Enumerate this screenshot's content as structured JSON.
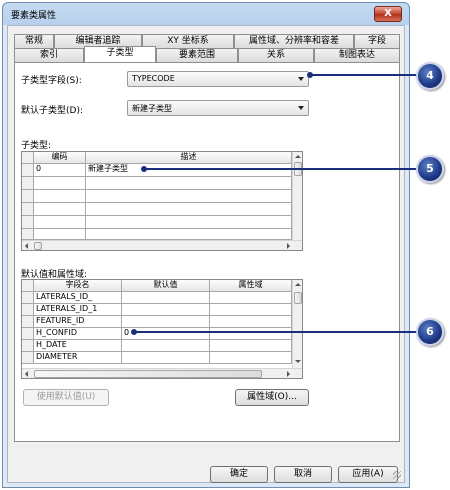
{
  "window": {
    "title": "要素类属性",
    "close_label": "X"
  },
  "tabs": {
    "row1": [
      "常规",
      "编辑者追踪",
      "XY 坐标系",
      "属性域、分辨率和容差",
      "字段"
    ],
    "row2": [
      "索引",
      "子类型",
      "要素范围",
      "关系",
      "制图表达"
    ],
    "active": "子类型"
  },
  "subtype_field": {
    "label": "子类型字段(S):",
    "value": "TYPECODE"
  },
  "default_subtype": {
    "label": "默认子类型(D):",
    "value": "新建子类型"
  },
  "subtypes": {
    "label": "子类型:",
    "columns": [
      "编码",
      "描述"
    ],
    "rows": [
      {
        "code": "0",
        "description": "新建子类型"
      }
    ]
  },
  "defaults": {
    "label": "默认值和属性域:",
    "columns": [
      "字段名",
      "默认值",
      "属性域"
    ],
    "rows": [
      {
        "field": "LATERALS_ID_",
        "default": "",
        "domain": ""
      },
      {
        "field": "LATERALS_ID_1",
        "default": "",
        "domain": ""
      },
      {
        "field": "FEATURE_ID",
        "default": "",
        "domain": ""
      },
      {
        "field": "H_CONFID",
        "default": "0",
        "domain": ""
      },
      {
        "field": "H_DATE",
        "default": "",
        "domain": ""
      },
      {
        "field": "DIAMETER",
        "default": "",
        "domain": ""
      }
    ]
  },
  "buttons": {
    "use_defaults": "使用默认值(U)",
    "domains": "属性域(O)...",
    "ok": "确定",
    "cancel": "取消",
    "apply": "应用(A)"
  },
  "callouts": [
    "4",
    "5",
    "6"
  ],
  "colors": {
    "callout": "#1c3784",
    "callout_line": "#1a2f7c"
  }
}
